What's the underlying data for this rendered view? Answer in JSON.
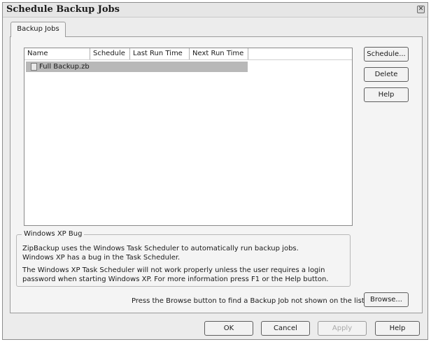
{
  "window": {
    "title": "Schedule Backup Jobs",
    "close_glyph": "✕"
  },
  "tabs": [
    {
      "label": "Backup Jobs",
      "selected": true
    }
  ],
  "list": {
    "columns": [
      "Name",
      "Schedule",
      "Last Run Time",
      "Next Run Time"
    ],
    "rows": [
      {
        "name": "Full Backup.zb",
        "schedule": "",
        "last_run": "",
        "next_run": "",
        "selected": true,
        "icon": "document-icon"
      }
    ]
  },
  "side_buttons": {
    "schedule": "Schedule...",
    "delete": "Delete",
    "help": "Help"
  },
  "notice": {
    "title": "Windows XP Bug",
    "line1": "ZipBackup uses the Windows Task Scheduler to automatically run backup jobs.",
    "line2": "Windows XP has a bug in the Task Scheduler.",
    "line3": "The Windows XP Task Scheduler will not work properly unless the user requires a login",
    "line4": "password when starting Windows XP. For more information press F1 or the Help button."
  },
  "browse": {
    "hint": "Press the Browse button to find a Backup Job not shown on the list",
    "button": "Browse..."
  },
  "footer": {
    "ok": "OK",
    "cancel": "Cancel",
    "apply": "Apply",
    "apply_enabled": false,
    "help": "Help"
  }
}
